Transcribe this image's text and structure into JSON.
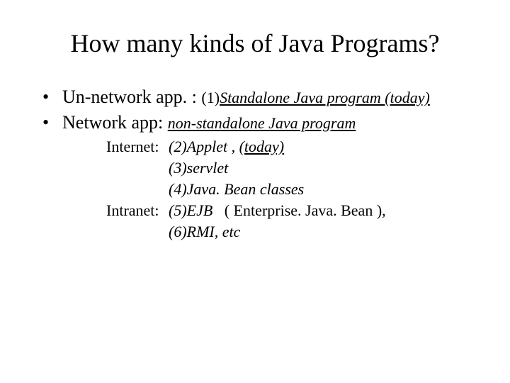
{
  "title": "How many kinds of Java Programs?",
  "bullets": [
    {
      "label": "Un-network app. :",
      "desc_prefix": "(1)",
      "desc": "Standalone Java program (today)"
    },
    {
      "label": "Network app:",
      "desc": "non-standalone Java program"
    }
  ],
  "sub": {
    "internet_label": "Internet:",
    "intranet_label": "Intranet:",
    "items": [
      "(2)Applet ,",
      "(today)",
      "(3)servlet",
      "(4)Java. Bean classes",
      "(5)EJB",
      "( Enterprise. Java. Bean ),",
      "(6)RMI, etc"
    ]
  }
}
